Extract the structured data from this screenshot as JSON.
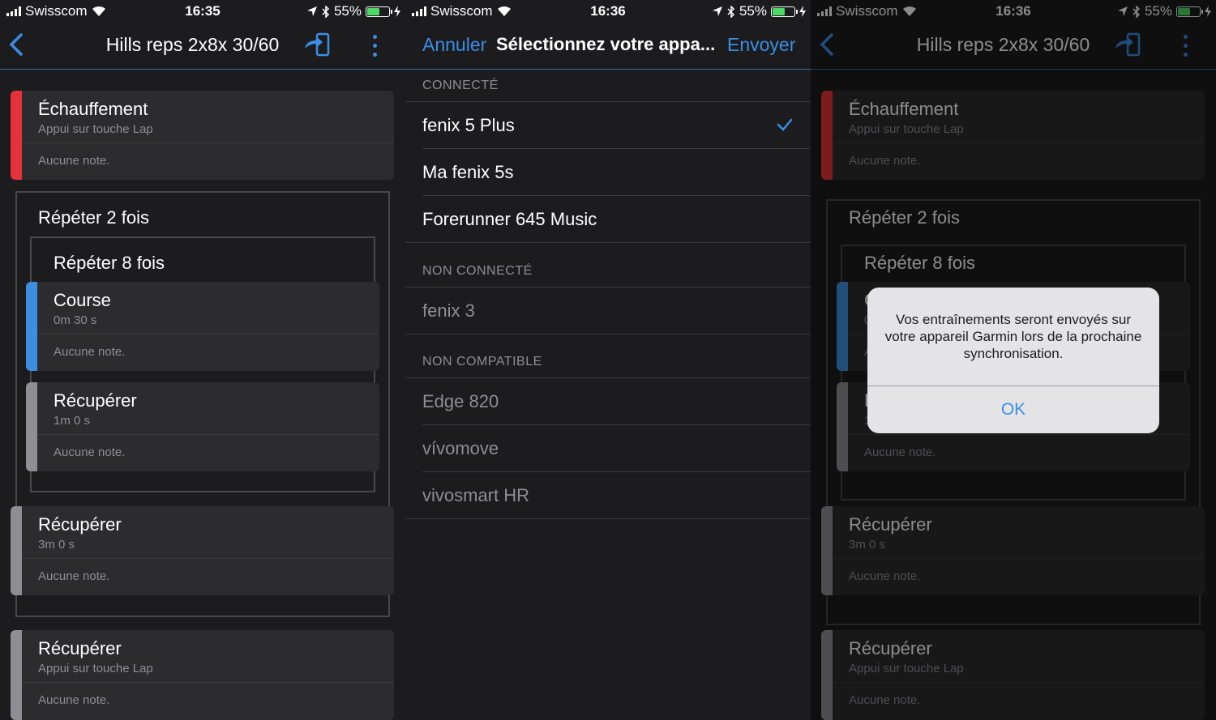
{
  "status": {
    "carrier": "Swisscom",
    "time_1": "16:35",
    "time_2": "16:36",
    "time_3": "16:36",
    "battery": "55%",
    "battery_level": 0.55,
    "battery_color": "#4cd964"
  },
  "workout": {
    "title": "Hills reps 2x8x 30/60",
    "warmup": {
      "name": "Échauffement",
      "sub": "Appui sur touche Lap",
      "note": "Aucune note.",
      "color": "#e5323a"
    },
    "repeat_outer": "Répéter 2 fois",
    "repeat_inner": "Répéter 8 fois",
    "run": {
      "name": "Course",
      "sub": "0m 30 s",
      "note": "Aucune note.",
      "color": "#3c8fe0"
    },
    "recover_inner": {
      "name": "Récupérer",
      "sub": "1m 0 s",
      "note": "Aucune note.",
      "color": "#8e8e93"
    },
    "recover_outer": {
      "name": "Récupérer",
      "sub": "3m 0 s",
      "note": "Aucune note.",
      "color": "#8e8e93"
    },
    "recover_last": {
      "name": "Récupérer",
      "sub": "Appui sur touche Lap",
      "note": "Aucune note.",
      "color": "#8e8e93"
    }
  },
  "device_select": {
    "cancel": "Annuler",
    "title": "Sélectionnez votre appa...",
    "send": "Envoyer",
    "sections": {
      "connected": "CONNECTÉ",
      "not_connected": "NON CONNECTÉ",
      "not_compatible": "NON COMPATIBLE"
    },
    "connected_devices": [
      "fenix 5 Plus",
      "Ma fenix 5s",
      "Forerunner 645 Music"
    ],
    "not_connected_devices": [
      "fenix 3"
    ],
    "not_compatible_devices": [
      "Edge 820",
      "vívomove",
      "vivosmart HR"
    ],
    "selected_device": "fenix 5 Plus",
    "accent": "#3a8ee6"
  },
  "alert": {
    "message": "Vos entraînements seront envoyés sur votre appareil Garmin lors de la prochaine synchronisation.",
    "ok": "OK"
  }
}
